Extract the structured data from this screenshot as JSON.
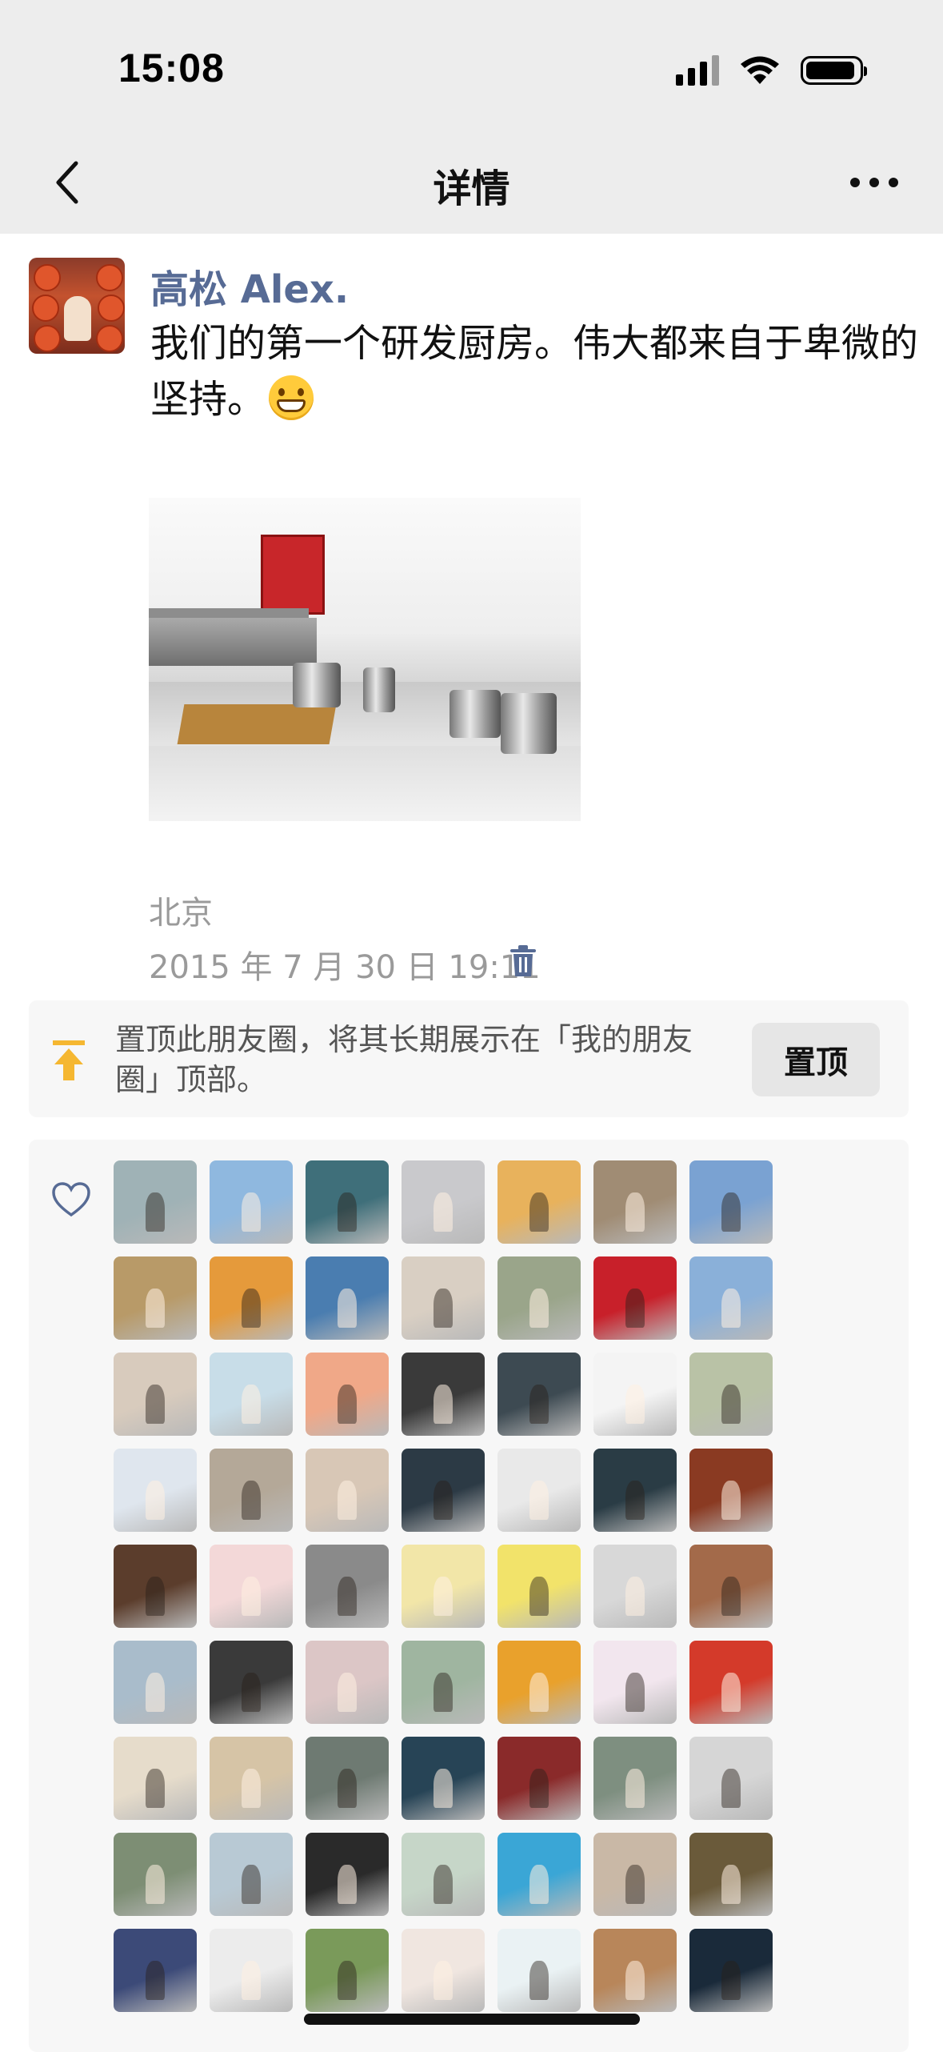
{
  "status_bar": {
    "time": "15:08"
  },
  "nav": {
    "title": "详情",
    "back_icon": "chevron-left-icon",
    "more_icon": "more-dots-icon"
  },
  "post": {
    "author": "高松 Alex.",
    "text": "我们的第一个研发厨房。伟大都来自于卑微的坚持。",
    "emoji": "grinning-face-icon",
    "location": "北京",
    "timestamp": "2015 年 7 月 30 日 19:11"
  },
  "pin": {
    "text": "置顶此朋友圈，将其长期展示在「我的朋友圈」顶部。",
    "button_label": "置顶"
  },
  "likes": {
    "rows_visible": 9,
    "avatar_colors": [
      [
        "#9fb2b6",
        "#8fb8df",
        "#3f6f7a",
        "#c9c9cc",
        "#e8b25c",
        "#a08c74",
        "#7aa2d2"
      ],
      [
        "#b89a68",
        "#e59a3b",
        "#4a7db0",
        "#d9cfc3",
        "#9aa58a",
        "#c8202a",
        "#8ab0d9"
      ],
      [
        "#d8cbbd",
        "#c8dde8",
        "#f0a888",
        "#3a3a3a",
        "#3d4a52",
        "#f4f4f4",
        "#b9c2a6"
      ],
      [
        "#dfe6ee",
        "#b4a898",
        "#d8c7b6",
        "#2c3a45",
        "#e9e9e9",
        "#2a3c45",
        "#8a3a22"
      ],
      [
        "#5b3d2c",
        "#f3d8d8",
        "#8a8a8a",
        "#f2e6a8",
        "#f2e36a",
        "#d8d8d8",
        "#a36a4a"
      ],
      [
        "#a9bccb",
        "#3a3a3a",
        "#dcc6c6",
        "#9fb5a0",
        "#e9a12c",
        "#f2e6ee",
        "#d43a2a"
      ],
      [
        "#e6dccb",
        "#d6c4a6",
        "#6e7a72",
        "#274456",
        "#8a2a2a",
        "#7e8f80",
        "#d6d6d6"
      ],
      [
        "#7d8e74",
        "#b8c9d4",
        "#2a2a2a",
        "#c6d6c8",
        "#3aa6d6",
        "#c9b8a6",
        "#6a5a3a"
      ],
      [
        "#3c4a78",
        "#ececec",
        "#7a9a5a",
        "#f0e6e0",
        "#eaf2f4",
        "#b8865a",
        "#1a2a3a"
      ]
    ]
  }
}
